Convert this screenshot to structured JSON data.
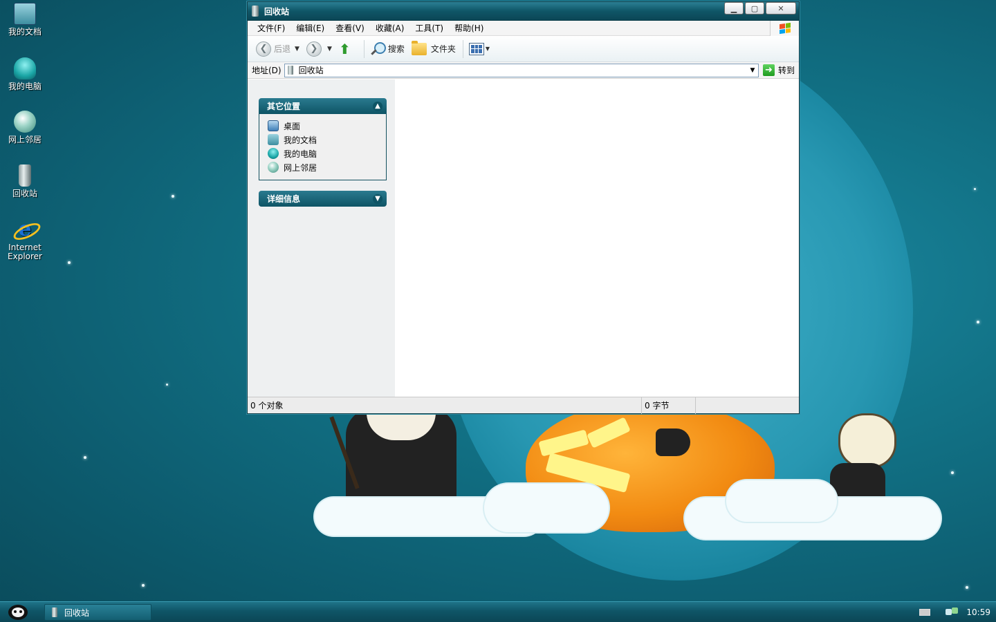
{
  "desktop": {
    "icons": [
      {
        "label": "我的文档",
        "icon": "my-documents-icon"
      },
      {
        "label": "我的电脑",
        "icon": "my-computer-icon"
      },
      {
        "label": "网上邻居",
        "icon": "network-places-icon"
      },
      {
        "label": "回收站",
        "icon": "recycle-bin-icon"
      },
      {
        "label_line1": "Internet",
        "label_line2": "Explorer",
        "icon": "internet-explorer-icon"
      }
    ]
  },
  "window": {
    "title": "回收站",
    "menu": [
      "文件(F)",
      "编辑(E)",
      "查看(V)",
      "收藏(A)",
      "工具(T)",
      "帮助(H)"
    ],
    "toolbar": {
      "back_label": "后退",
      "search_label": "搜索",
      "folders_label": "文件夹"
    },
    "address": {
      "label": "地址(D)",
      "value": "回收站",
      "go_label": "转到"
    },
    "side_panels": {
      "other_places": {
        "title": "其它位置",
        "links": [
          "桌面",
          "我的文档",
          "我的电脑",
          "网上邻居"
        ]
      },
      "details": {
        "title": "详细信息"
      }
    },
    "status": {
      "objects": "0 个对象",
      "size": "0 字节"
    }
  },
  "taskbar": {
    "task_label": "回收站",
    "clock": "10:59"
  }
}
